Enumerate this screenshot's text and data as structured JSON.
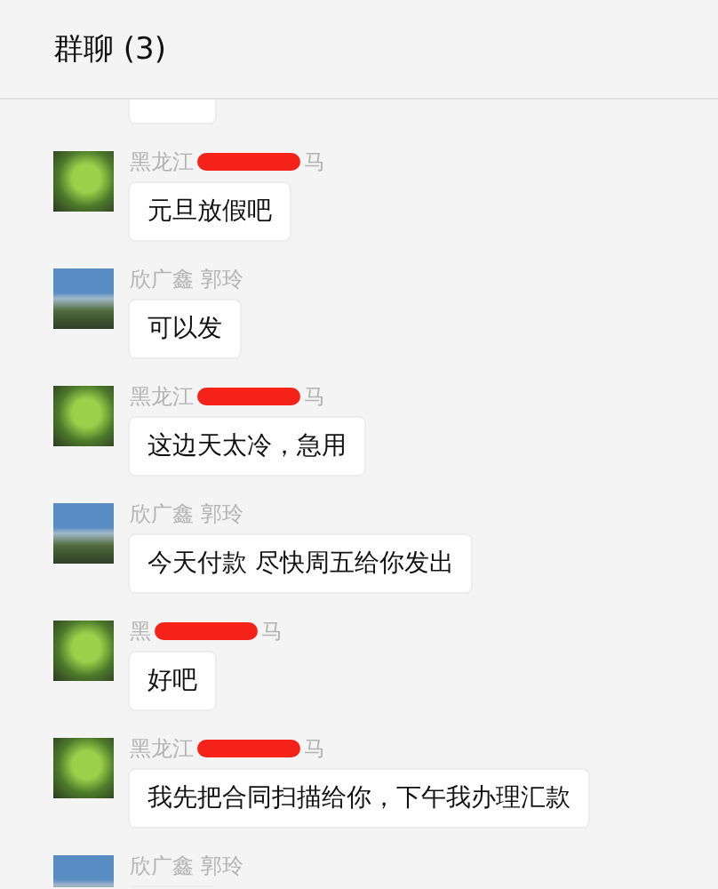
{
  "header": {
    "title": "群聊 (3)"
  },
  "messages": [
    {
      "kind": "cut"
    },
    {
      "kind": "text",
      "avatar": {
        "kind": "plant"
      },
      "sender": {
        "prefix": "黑龙江",
        "redacted": true,
        "suffix": "马"
      },
      "text": "元旦放假吧"
    },
    {
      "kind": "text",
      "avatar": {
        "kind": "landscape"
      },
      "sender": {
        "prefix": "欣广鑫 郭玲",
        "redacted": false
      },
      "text": "可以发"
    },
    {
      "kind": "text",
      "avatar": {
        "kind": "plant"
      },
      "sender": {
        "prefix": "黑龙江",
        "redacted": true,
        "suffix": "马"
      },
      "text": "这边天太冷，急用"
    },
    {
      "kind": "text",
      "avatar": {
        "kind": "landscape"
      },
      "sender": {
        "prefix": "欣广鑫 郭玲",
        "redacted": false
      },
      "text": "今天付款   尽快周五给你发出"
    },
    {
      "kind": "text",
      "avatar": {
        "kind": "plant"
      },
      "sender": {
        "prefix": "黑",
        "redacted": true,
        "suffix": "马"
      },
      "text": "好吧"
    },
    {
      "kind": "text",
      "avatar": {
        "kind": "plant"
      },
      "sender": {
        "prefix": "黑龙江",
        "redacted": true,
        "suffix": "马"
      },
      "text": "我先把合同扫描给你，下午我办理汇款"
    },
    {
      "kind": "text",
      "avatar": {
        "kind": "landscape"
      },
      "sender": {
        "prefix": "欣广鑫 郭玲",
        "redacted": false
      }
    }
  ]
}
